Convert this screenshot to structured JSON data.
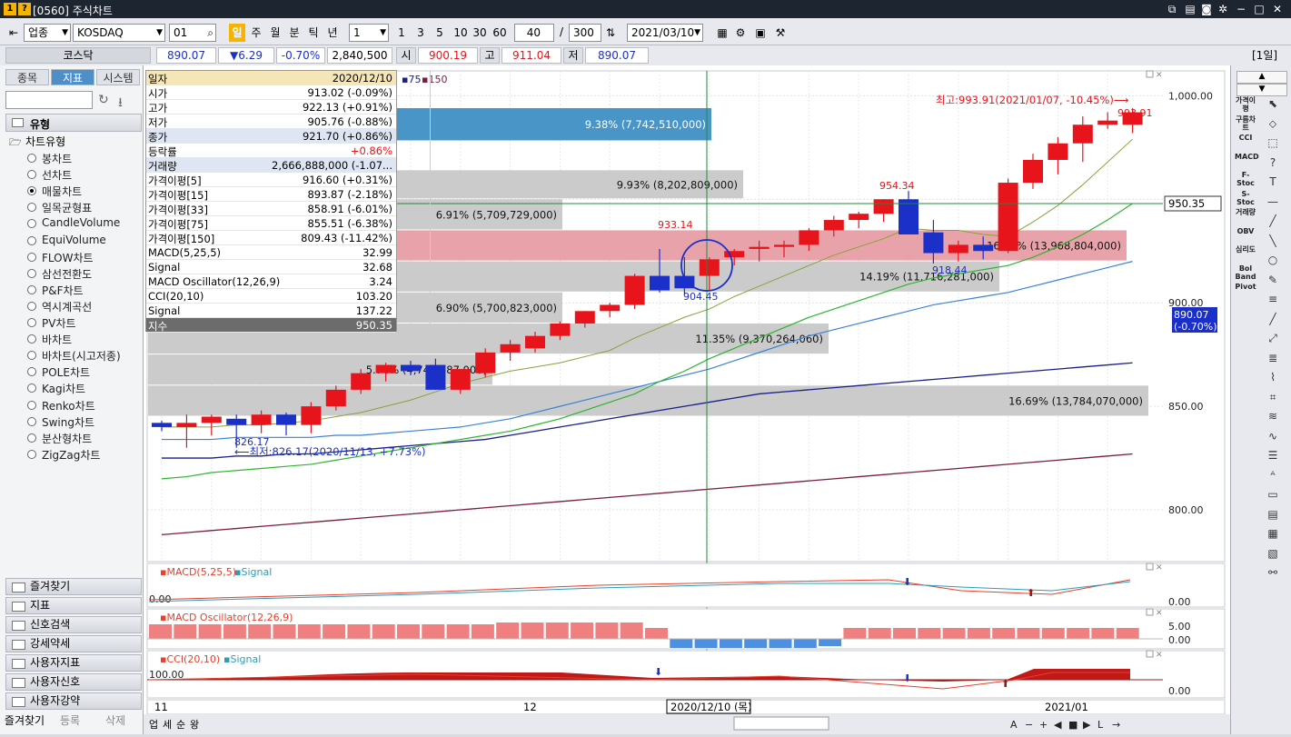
{
  "title": {
    "text": "[0560] 주식차트",
    "icon1": "1",
    "icon2": "?"
  },
  "toolbar": {
    "market_label": "업종",
    "market_name": "KOSDAQ",
    "code": "01",
    "period_buttons": [
      "일",
      "주",
      "월",
      "분",
      "틱",
      "년"
    ],
    "interval_value": "1",
    "interval_buttons": [
      "1",
      "3",
      "5",
      "10",
      "30",
      "60"
    ],
    "count_visible": "40",
    "count_total": "300",
    "date": "2021/03/10"
  },
  "pricebar": {
    "name": "코스닥",
    "price": "890.07",
    "change": "▼6.29",
    "change_pct": "-0.70%",
    "volume": "2,840,500",
    "open_label": "시",
    "open": "900.19",
    "high_label": "고",
    "high": "911.04",
    "low_label": "저",
    "low": "890.07",
    "period_badge": "[1일]"
  },
  "sidebar": {
    "tabs": [
      "종목",
      "지표",
      "시스템"
    ],
    "section_title": "유형",
    "tree_root": "차트유형",
    "items": [
      "봉차트",
      "선차트",
      "매물차트",
      "일목균형표",
      "CandleVolume",
      "EquiVolume",
      "FLOW차트",
      "삼선전환도",
      "P&F차트",
      "역시계곡선",
      "PV차트",
      "바차트",
      "바차트(시고저종)",
      "POLE차트",
      "Kagi차트",
      "Renko차트",
      "Swing차트",
      "분산형차트",
      "ZigZag차트"
    ],
    "selected_index": 2,
    "bottom_buttons": [
      "즐겨찾기",
      "지표",
      "신호검색",
      "강세약세",
      "사용자지표",
      "사용자신호",
      "사용자강약"
    ],
    "footer_tabs": [
      "즐겨찾기",
      "등록",
      "삭제"
    ]
  },
  "info": {
    "rows": [
      {
        "k": "일자",
        "v": "2020/12/10"
      },
      {
        "k": "시가",
        "v": "913.02 (-0.09%)"
      },
      {
        "k": "고가",
        "v": "922.13 (+0.91%)"
      },
      {
        "k": "저가",
        "v": "905.76 (-0.88%)"
      },
      {
        "k": "종가",
        "v": "921.70 (+0.86%)"
      },
      {
        "k": "등락률",
        "v": "+0.86%"
      },
      {
        "k": "거래량",
        "v": "2,666,888,000 (-1.07..."
      },
      {
        "k": "가격이평[5]",
        "v": "916.60 (+0.31%)"
      },
      {
        "k": "가격이평[15]",
        "v": "893.87 (-2.18%)"
      },
      {
        "k": "가격이평[33]",
        "v": "858.91 (-6.01%)"
      },
      {
        "k": "가격이평[75]",
        "v": "855.51 (-6.38%)"
      },
      {
        "k": "가격이평[150]",
        "v": "809.43 (-11.42%)"
      },
      {
        "k": "MACD(5,25,5)",
        "v": "32.99"
      },
      {
        "k": "Signal",
        "v": "32.68"
      },
      {
        "k": "MACD Oscillator(12,26,9)",
        "v": "3.24"
      },
      {
        "k": "CCI(20,10)",
        "v": "103.20"
      },
      {
        "k": "Signal",
        "v": "137.22"
      },
      {
        "k": "지수",
        "v": "950.35"
      }
    ]
  },
  "chart_data": {
    "type": "candlestick",
    "legend": [
      "75",
      "150"
    ],
    "ylim": [
      775,
      1012
    ],
    "y_ticks": [
      "1,000.00",
      "950.00",
      "900.00",
      "850.00",
      "800.00"
    ],
    "x_labels": [
      "11",
      "12",
      "2021/01"
    ],
    "crosshair_date": "2020/12/10 (목)",
    "crosshair_value": "950.35",
    "last_price_label": [
      "890.07",
      "(-0.70%)"
    ],
    "candles": [
      [
        842,
        843,
        838,
        840
      ],
      [
        840,
        846,
        830,
        842
      ],
      [
        842,
        846,
        836,
        845
      ],
      [
        844,
        846,
        830,
        841
      ],
      [
        841,
        848,
        837,
        846
      ],
      [
        846,
        847,
        836,
        841
      ],
      [
        841,
        852,
        837,
        850
      ],
      [
        850,
        860,
        848,
        858
      ],
      [
        858,
        868,
        856,
        866
      ],
      [
        866,
        871,
        862,
        870
      ],
      [
        870,
        872,
        865,
        867
      ],
      [
        870,
        873,
        858,
        858
      ],
      [
        858,
        868,
        856,
        868
      ],
      [
        866,
        878,
        864,
        876
      ],
      [
        876,
        882,
        872,
        880
      ],
      [
        878,
        886,
        876,
        884
      ],
      [
        884,
        891,
        882,
        890
      ],
      [
        890,
        896,
        888,
        896
      ],
      [
        896,
        900,
        893,
        899
      ],
      [
        899,
        914,
        897,
        913
      ],
      [
        913,
        926,
        905,
        906
      ],
      [
        913,
        922,
        904,
        907
      ],
      [
        913,
        922,
        906,
        921
      ],
      [
        922,
        926,
        918,
        925
      ],
      [
        926,
        930,
        920,
        927
      ],
      [
        927,
        930,
        922,
        928
      ],
      [
        928,
        936,
        925,
        935
      ],
      [
        935,
        942,
        932,
        940
      ],
      [
        940,
        944,
        936,
        943
      ],
      [
        943,
        950,
        939,
        950
      ],
      [
        950,
        954,
        944,
        933
      ],
      [
        934,
        940,
        919,
        924
      ],
      [
        924,
        930,
        920,
        928
      ],
      [
        928,
        932,
        921,
        925
      ],
      [
        925,
        960,
        924,
        958
      ],
      [
        958,
        972,
        955,
        969
      ],
      [
        969,
        980,
        962,
        977
      ],
      [
        977,
        990,
        968,
        986
      ],
      [
        986,
        992,
        984,
        988
      ],
      [
        986,
        994,
        982,
        992
      ]
    ],
    "ma5": [
      840,
      840,
      840,
      841,
      841,
      842,
      843,
      845,
      847,
      850,
      853,
      857,
      861,
      864,
      867,
      869,
      871,
      874,
      877,
      883,
      888,
      893,
      897,
      903,
      908,
      913,
      918,
      923,
      927,
      931,
      936,
      935,
      935,
      933,
      932,
      939,
      947,
      957,
      968,
      979
    ],
    "ma15": [
      815,
      816,
      818,
      819,
      820,
      821,
      822,
      824,
      826,
      828,
      830,
      832,
      834,
      836,
      838,
      841,
      844,
      848,
      852,
      856,
      862,
      867,
      873,
      878,
      883,
      888,
      893,
      897,
      901,
      905,
      909,
      912,
      914,
      916,
      918,
      922,
      927,
      933,
      940,
      948
    ],
    "ma75": [
      834,
      834,
      834,
      835,
      835,
      835,
      835,
      836,
      836,
      837,
      838,
      839,
      840,
      842,
      844,
      847,
      850,
      853,
      856,
      859,
      862,
      865,
      868,
      872,
      876,
      880,
      884,
      887,
      890,
      893,
      896,
      899,
      901,
      903,
      905,
      908,
      911,
      914,
      917,
      920
    ],
    "ma150": [
      825,
      825,
      825,
      826,
      826,
      827,
      827,
      828,
      829,
      830,
      831,
      832,
      833,
      834,
      836,
      838,
      840,
      842,
      844,
      846,
      848,
      850,
      852,
      854,
      856,
      857,
      858,
      859,
      860,
      861,
      862,
      863,
      864,
      865,
      866,
      867,
      868,
      869,
      870,
      871
    ],
    "ma_long": [
      788,
      789,
      790,
      791,
      792,
      793,
      794,
      795,
      796,
      797,
      798,
      799,
      800,
      801,
      802,
      803,
      804,
      805,
      806,
      807,
      808,
      809,
      810,
      811,
      812,
      813,
      814,
      815,
      816,
      817,
      818,
      819,
      820,
      821,
      822,
      823,
      824,
      825,
      826,
      827
    ],
    "volume_profile": [
      {
        "lo": 994,
        "hi": 1006,
        "pct": "",
        "len": 0
      },
      {
        "lo": 978,
        "hi": 994,
        "pct": "9.38% (7,742,510,000)",
        "len": 620,
        "color": "#3f8fc4"
      },
      {
        "lo": 950,
        "hi": 964,
        "pct": "9.93% (8,202,809,000)",
        "len": 655
      },
      {
        "lo": 935,
        "hi": 950,
        "pct": "6.91% (5,709,729,000)",
        "len": 456
      },
      {
        "lo": 920,
        "hi": 935,
        "pct": "16.92% (13,968,804,000)",
        "len": 1077,
        "color": "#e69ea4"
      },
      {
        "lo": 905,
        "hi": 920,
        "pct": "14.19% (11,716,281,000)",
        "len": 937
      },
      {
        "lo": 890,
        "hi": 905,
        "pct": "6.90% (5,700,823,000)",
        "len": 456
      },
      {
        "lo": 875,
        "hi": 890,
        "pct": "11.35% (9,370,264,060)",
        "len": 749
      },
      {
        "lo": 860,
        "hi": 875,
        "pct": "5.74% (4,743,587,000)",
        "len": 379
      },
      {
        "lo": 845,
        "hi": 860,
        "pct": "16.69% (13,784,070,000)",
        "len": 1101
      }
    ],
    "annotations": {
      "high": "최고:993.91(2021/01/07, -10.45%)",
      "high_val": "993.91",
      "low": "최저:826.17(2020/11/13, +7.73%)",
      "low_val": "826.17",
      "p933": "933.14",
      "p904": "904.45",
      "p954": "954.34",
      "p918": "918.44"
    },
    "macd_label": "MACD(5,25,5)",
    "macd_signal_label": "Signal",
    "macd_left_val": "0.00",
    "macd_axis": "0.00",
    "osc_label": "MACD Oscillator(12,26,9)",
    "osc_axis_top": "5.00",
    "osc_axis_bot": "0.00",
    "osc_values": [
      3,
      3,
      3,
      3,
      3,
      3,
      3,
      3,
      3,
      3,
      3,
      3,
      3,
      3,
      3,
      3,
      3,
      3,
      3,
      3,
      3,
      3,
      3,
      3,
      3,
      3,
      3,
      3,
      3,
      3,
      3,
      3,
      3,
      3,
      3,
      3,
      3,
      3,
      3,
      3,
      3,
      3,
      3,
      3,
      3,
      3,
      3,
      3,
      3,
      3,
      3,
      3,
      3,
      3,
      3,
      3,
      3,
      3,
      3,
      3,
      3,
      3,
      3,
      3,
      3,
      3,
      3,
      3,
      3,
      3,
      3,
      3,
      3,
      3,
      3,
      3,
      3,
      3,
      3,
      3,
      3,
      3,
      3,
      3,
      3,
      3,
      3,
      3,
      3,
      3,
      3,
      3,
      3,
      3,
      3,
      3,
      3,
      3,
      3,
      3
    ],
    "cci_label": "CCI(20,10)",
    "cci_signal_label": "Signal",
    "cci_left_val": "100.00",
    "cci_axis": "0.00"
  },
  "bottom": {
    "tabs": [
      "업",
      "세",
      "순",
      "왕"
    ]
  },
  "right_tools": [
    "가격이평",
    "구름차트",
    "CCI",
    "MACD",
    "F-Stoc",
    "S-Stoc",
    "거래량",
    "OBV",
    "심리도",
    "Bol Band",
    "Pivot"
  ],
  "colors": {
    "up": "#e8141b",
    "down": "#1b2fc9",
    "accent": "#4e8fc7",
    "ma5": "#ff7f4c",
    "ma15": "#2fb52f",
    "ma75": "#3a83d6",
    "ma150": "#1a1f8c",
    "malong": "#7a1c44"
  }
}
